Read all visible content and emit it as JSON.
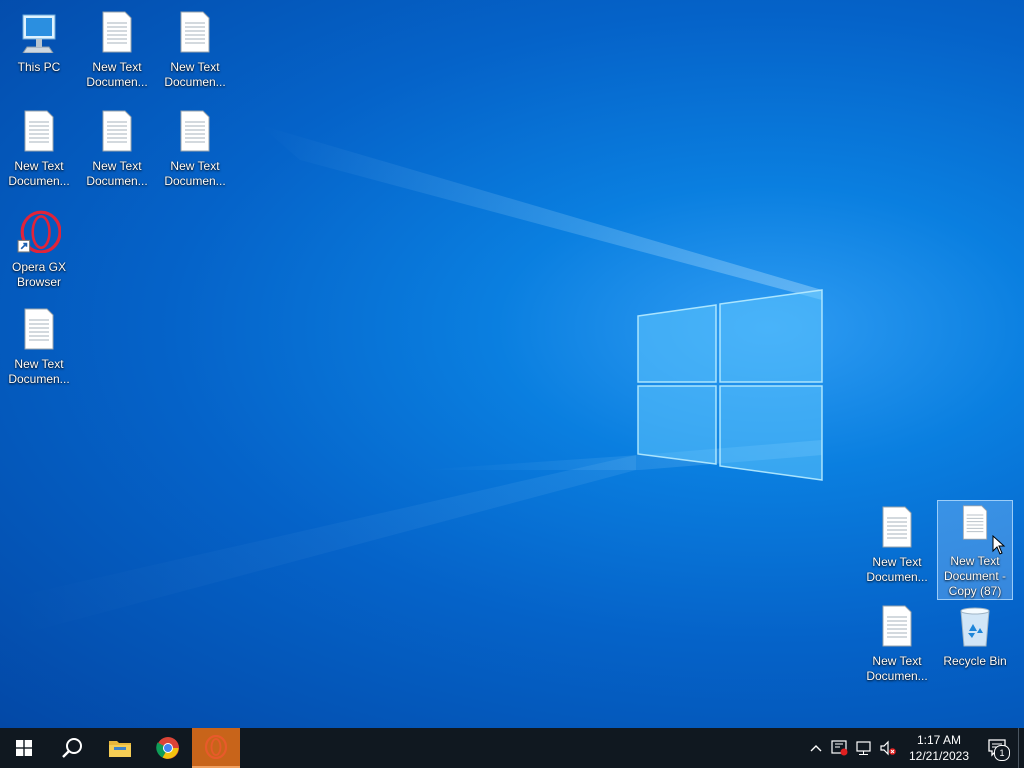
{
  "desktop": {
    "icons": [
      {
        "label": "This PC",
        "type": "this-pc"
      },
      {
        "label": "New Text Documen...",
        "type": "text-doc"
      },
      {
        "label": "New Text Documen...",
        "type": "text-doc"
      },
      {
        "label": "New Text Documen...",
        "type": "text-doc"
      },
      {
        "label": "New Text Documen...",
        "type": "text-doc"
      },
      {
        "label": "New Text Documen...",
        "type": "text-doc"
      },
      {
        "label": "Opera GX Browser",
        "type": "opera-gx-shortcut"
      },
      {
        "label": "New Text Documen...",
        "type": "text-doc"
      },
      {
        "label": "New Text Documen...",
        "type": "text-doc"
      },
      {
        "label": "New Text Document - Copy (87)",
        "type": "text-doc",
        "selected": true
      },
      {
        "label": "New Text Documen...",
        "type": "text-doc"
      },
      {
        "label": "Recycle Bin",
        "type": "recycle-bin"
      }
    ]
  },
  "taskbar": {
    "buttons": [
      {
        "name": "start-button",
        "icon": "windows-logo-icon"
      },
      {
        "name": "search-button",
        "icon": "search-icon"
      },
      {
        "name": "file-explorer-button",
        "icon": "folder-icon"
      },
      {
        "name": "chrome-button",
        "icon": "chrome-icon"
      },
      {
        "name": "opera-gx-button",
        "icon": "opera-gx-icon",
        "active": true
      }
    ],
    "tray": {
      "icons": [
        "chevron-up-icon",
        "security-warning-icon",
        "network-icon",
        "volume-muted-icon"
      ],
      "time": "1:17 AM",
      "date": "12/21/2023",
      "notification_count": "1"
    }
  },
  "colors": {
    "taskbar_bg": "#101820",
    "active_app": "#c8641a",
    "selection": "#96c8ff"
  }
}
